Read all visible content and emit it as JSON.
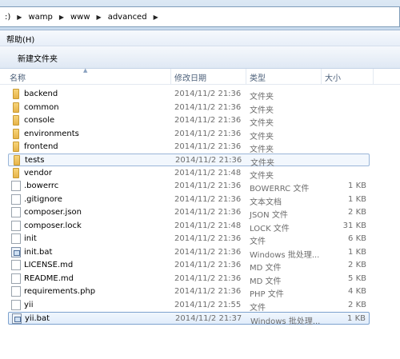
{
  "address": {
    "items": [
      ":)",
      "wamp",
      "www",
      "advanced"
    ]
  },
  "menu": {
    "help_label": "帮助(H)"
  },
  "toolbar": {
    "new_folder_label": "新建文件夹"
  },
  "columns": {
    "name": "名称",
    "date": "修改日期",
    "type": "类型",
    "size": "大小"
  },
  "files": [
    {
      "name": "backend",
      "date": "2014/11/2 21:36",
      "type": "文件夹",
      "size": "",
      "icon": "folder-icon"
    },
    {
      "name": "common",
      "date": "2014/11/2 21:36",
      "type": "文件夹",
      "size": "",
      "icon": "folder-icon"
    },
    {
      "name": "console",
      "date": "2014/11/2 21:36",
      "type": "文件夹",
      "size": "",
      "icon": "folder-icon"
    },
    {
      "name": "environments",
      "date": "2014/11/2 21:36",
      "type": "文件夹",
      "size": "",
      "icon": "folder-icon"
    },
    {
      "name": "frontend",
      "date": "2014/11/2 21:36",
      "type": "文件夹",
      "size": "",
      "icon": "folder-icon"
    },
    {
      "name": "tests",
      "date": "2014/11/2 21:36",
      "type": "文件夹",
      "size": "",
      "icon": "folder-icon"
    },
    {
      "name": "vendor",
      "date": "2014/11/2 21:48",
      "type": "文件夹",
      "size": "",
      "icon": "folder-icon"
    },
    {
      "name": ".bowerrc",
      "date": "2014/11/2 21:36",
      "type": "BOWERRC 文件",
      "size": "1 KB",
      "icon": "file-icon"
    },
    {
      "name": ".gitignore",
      "date": "2014/11/2 21:36",
      "type": "文本文档",
      "size": "1 KB",
      "icon": "file-icon"
    },
    {
      "name": "composer.json",
      "date": "2014/11/2 21:36",
      "type": "JSON 文件",
      "size": "2 KB",
      "icon": "file-icon"
    },
    {
      "name": "composer.lock",
      "date": "2014/11/2 21:48",
      "type": "LOCK 文件",
      "size": "31 KB",
      "icon": "file-icon"
    },
    {
      "name": "init",
      "date": "2014/11/2 21:36",
      "type": "文件",
      "size": "6 KB",
      "icon": "file-icon"
    },
    {
      "name": "init.bat",
      "date": "2014/11/2 21:36",
      "type": "Windows 批处理...",
      "size": "1 KB",
      "icon": "bat-file-icon"
    },
    {
      "name": "LICENSE.md",
      "date": "2014/11/2 21:36",
      "type": "MD 文件",
      "size": "2 KB",
      "icon": "file-icon"
    },
    {
      "name": "README.md",
      "date": "2014/11/2 21:36",
      "type": "MD 文件",
      "size": "5 KB",
      "icon": "file-icon"
    },
    {
      "name": "requirements.php",
      "date": "2014/11/2 21:36",
      "type": "PHP 文件",
      "size": "4 KB",
      "icon": "file-icon"
    },
    {
      "name": "yii",
      "date": "2014/11/2 21:55",
      "type": "文件",
      "size": "2 KB",
      "icon": "file-icon"
    },
    {
      "name": "yii.bat",
      "date": "2014/11/2 21:37",
      "type": "Windows 批处理...",
      "size": "1 KB",
      "icon": "bat-file-icon"
    }
  ]
}
